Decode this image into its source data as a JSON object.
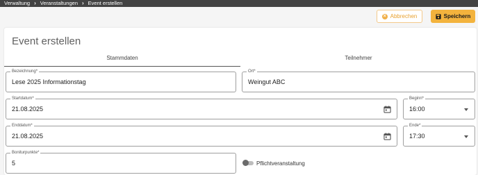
{
  "breadcrumb": {
    "items": [
      "Verwaltung",
      "Veranstaltungen",
      "Event erstellen"
    ],
    "separator": "›"
  },
  "toolbar": {
    "cancel_label": "Abbrechen",
    "save_label": "Speichern"
  },
  "page": {
    "title": "Event erstellen"
  },
  "tabs": [
    {
      "label": "Stammdaten",
      "active": true
    },
    {
      "label": "Teilnehmer",
      "active": false
    }
  ],
  "form": {
    "bezeichnung": {
      "label": "Bezeichnung*",
      "value": "Lese 2025 Informationstag"
    },
    "ort": {
      "label": "Ort*",
      "value": "Weingut ABC"
    },
    "startdatum": {
      "label": "Startdatum*",
      "value": "21.08.2025"
    },
    "beginn": {
      "label": "Beginn*",
      "value": "16:00"
    },
    "enddatum": {
      "label": "Enddatum*",
      "value": "21.08.2025"
    },
    "ende": {
      "label": "Ende*",
      "value": "17:30"
    },
    "boniturpunkte": {
      "label": "Boniturpunkte*",
      "value": "5"
    },
    "pflichtveranstaltung": {
      "label": "Pflichtveranstaltung",
      "checked": false
    }
  },
  "colors": {
    "accent": "#f3b33d",
    "breadcrumb_bg": "#434343"
  },
  "icons": [
    "chevron-right-icon",
    "cancel-icon",
    "save-icon",
    "calendar-icon",
    "caret-down-icon"
  ]
}
